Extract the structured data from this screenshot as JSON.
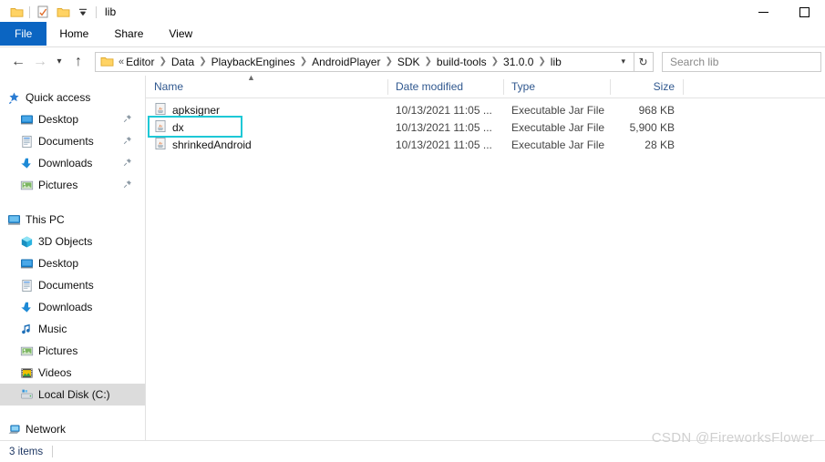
{
  "window": {
    "title": "lib",
    "quick_access_icons": [
      "folder-icon",
      "properties-icon",
      "new-folder-icon",
      "customize-dropdown-icon"
    ],
    "controls": {
      "minimize": "minimize-icon",
      "maximize": "maximize-icon"
    }
  },
  "ribbon": {
    "tabs": [
      {
        "label": "File",
        "active": true
      },
      {
        "label": "Home",
        "active": false
      },
      {
        "label": "Share",
        "active": false
      },
      {
        "label": "View",
        "active": false
      }
    ]
  },
  "address": {
    "back": "back-arrow-icon",
    "forward": "forward-arrow-icon",
    "recent": "recent-locations-icon",
    "up": "up-arrow-icon",
    "overflow": "«",
    "breadcrumbs": [
      "Editor",
      "Data",
      "PlaybackEngines",
      "AndroidPlayer",
      "SDK",
      "build-tools",
      "31.0.0",
      "lib"
    ],
    "dropdown": "chevron-down-icon",
    "refresh": "refresh-icon",
    "search_placeholder": "Search lib",
    "search_value": ""
  },
  "navpane": {
    "groups": [
      {
        "header": {
          "label": "Quick access",
          "icon": "star-pin-icon"
        },
        "items": [
          {
            "label": "Desktop",
            "icon": "desktop-icon",
            "pinned": true
          },
          {
            "label": "Documents",
            "icon": "documents-icon",
            "pinned": true
          },
          {
            "label": "Downloads",
            "icon": "downloads-icon",
            "pinned": true
          },
          {
            "label": "Pictures",
            "icon": "pictures-icon",
            "pinned": true
          }
        ]
      },
      {
        "header": {
          "label": "This PC",
          "icon": "this-pc-icon"
        },
        "items": [
          {
            "label": "3D Objects",
            "icon": "3d-objects-icon",
            "pinned": false
          },
          {
            "label": "Desktop",
            "icon": "desktop-icon",
            "pinned": false
          },
          {
            "label": "Documents",
            "icon": "documents-icon",
            "pinned": false
          },
          {
            "label": "Downloads",
            "icon": "downloads-icon",
            "pinned": false
          },
          {
            "label": "Music",
            "icon": "music-icon",
            "pinned": false
          },
          {
            "label": "Pictures",
            "icon": "pictures-icon",
            "pinned": false
          },
          {
            "label": "Videos",
            "icon": "videos-icon",
            "pinned": false
          },
          {
            "label": "Local Disk (C:)",
            "icon": "local-disk-icon",
            "pinned": false,
            "selected": true
          }
        ]
      },
      {
        "header": {
          "label": "Network",
          "icon": "network-icon"
        },
        "items": []
      }
    ]
  },
  "filelist": {
    "columns": [
      {
        "key": "name",
        "label": "Name",
        "sorted": "asc"
      },
      {
        "key": "date",
        "label": "Date modified"
      },
      {
        "key": "type",
        "label": "Type"
      },
      {
        "key": "size",
        "label": "Size"
      }
    ],
    "rows": [
      {
        "name": "apksigner",
        "date": "10/13/2021 11:05 ...",
        "type": "Executable Jar File",
        "size": "968 KB",
        "icon": "jar-file-icon",
        "annotated": false
      },
      {
        "name": "dx",
        "date": "10/13/2021 11:05 ...",
        "type": "Executable Jar File",
        "size": "5,900 KB",
        "icon": "jar-file-icon",
        "annotated": true
      },
      {
        "name": "shrinkedAndroid",
        "date": "10/13/2021 11:05 ...",
        "type": "Executable Jar File",
        "size": "28 KB",
        "icon": "jar-file-icon",
        "annotated": false
      }
    ]
  },
  "statusbar": {
    "item_count": "3 items"
  },
  "watermark": {
    "text": "CSDN @FireworksFlower"
  },
  "colors": {
    "accent": "#0b65c2",
    "annotation": "#1ec8d6",
    "column_header_text": "#30588f",
    "status_text": "#1f3864",
    "selection": "#dcdcdc",
    "watermark": "#cfcfcf"
  }
}
